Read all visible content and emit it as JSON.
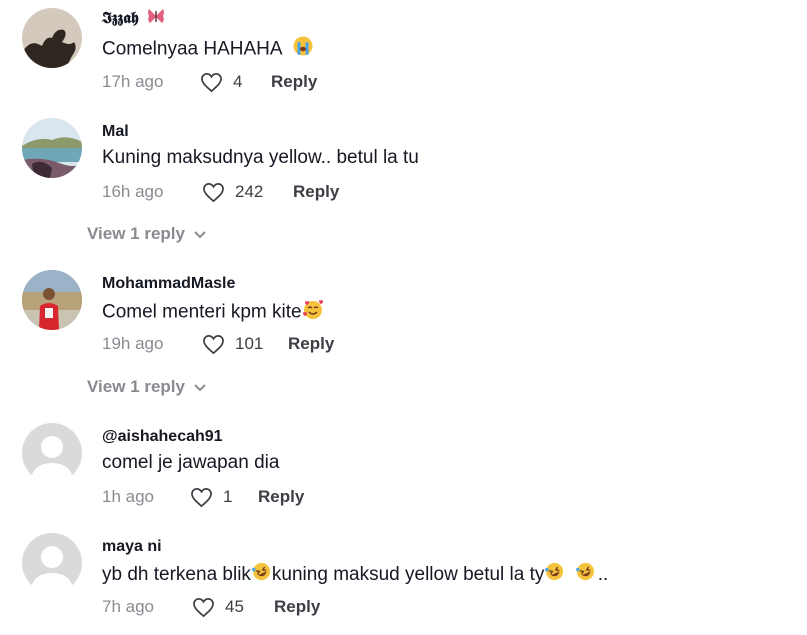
{
  "comments": [
    {
      "username": "𝕴𝖟𝖟𝖆𝖍",
      "username_icon": "butterfly-icon",
      "text": "Comelnyaa HAHAHA",
      "text_emoji": "crying-face-icon",
      "time": "17h ago",
      "likes": "4",
      "reply_label": "Reply",
      "avatar": "silhouette-avatar"
    },
    {
      "username": "Mal",
      "text": "Kuning maksudnya yellow.. betul la tu",
      "time": "16h ago",
      "likes": "242",
      "reply_label": "Reply",
      "avatar": "landscape-avatar",
      "view_replies": "View 1 reply"
    },
    {
      "username": "MohammadMasle",
      "text": "Comel menteri kpm kite",
      "text_emoji": "smiling-face-with-hearts-icon",
      "time": "19h ago",
      "likes": "101",
      "reply_label": "Reply",
      "avatar": "person-avatar",
      "view_replies": "View 1 reply"
    },
    {
      "username": "@aishahecah91",
      "text": "comel je jawapan dia",
      "time": "1h ago",
      "likes": "1",
      "reply_label": "Reply",
      "avatar": "default-avatar"
    },
    {
      "username": "maya ni",
      "text_parts": [
        "yb dh terkena blik",
        "kuning maksud yellow betul la ty",
        ".."
      ],
      "text_emoji": "rolling-on-floor-laughing-icon",
      "time": "7h ago",
      "likes": "45",
      "reply_label": "Reply",
      "avatar": "default-avatar"
    }
  ],
  "colors": {
    "primary_text": "#161823",
    "secondary_text": "#8a8b91",
    "action_text": "#3d3e45",
    "default_avatar_bg": "#d9dadc"
  }
}
